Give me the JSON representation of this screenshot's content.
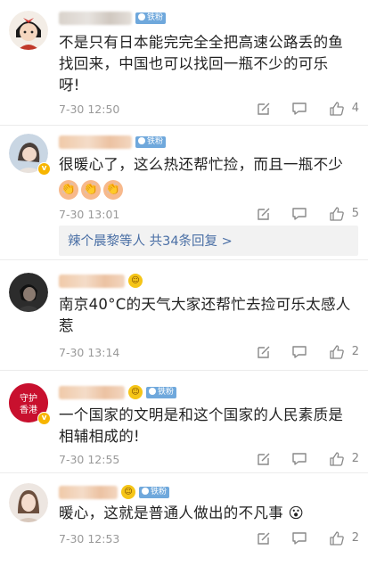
{
  "badges": {
    "fan_label": "铁粉"
  },
  "comments": [
    {
      "text_lines": [
        "不是只有日本能完完全全把高速公路丢的鱼",
        "找回来，中国也可以找回一瓶不少的可乐",
        "呀!"
      ],
      "time": "7-30 12:50",
      "likes": "4",
      "avatar_icon": "cartoon-girl-avatar",
      "has_fan_badge": true
    },
    {
      "text_lines": [
        "很暖心了，这么热还帮忙捡，而且一瓶不少"
      ],
      "emojis": [
        "clap-emoji",
        "clap-emoji",
        "clap-emoji"
      ],
      "time": "7-30 13:01",
      "likes": "5",
      "avatar_icon": "girl-photo-avatar",
      "has_fan_badge": true,
      "reply_summary": "辣个晨黎等人  共34条回复 >"
    },
    {
      "text_lines": [
        "南京40°C的天气大家还帮忙去捡可乐太感人",
        "惹"
      ],
      "time": "7-30 13:14",
      "likes": "2",
      "avatar_icon": "dark-portrait-avatar",
      "has_fan_badge": false
    },
    {
      "text_lines": [
        "一个国家的文明是和这个国家的人民素质是",
        "相辅相成的!"
      ],
      "time": "7-30 12:55",
      "likes": "2",
      "avatar_icon": "hongkong-logo-avatar",
      "avatar_text": [
        "守护",
        "香港"
      ],
      "has_fan_badge": true
    },
    {
      "text_lines": [
        "暖心，这就是普通人做出的不凡事 😮"
      ],
      "time": "7-30 12:53",
      "likes": "2",
      "avatar_icon": "woman-photo-avatar",
      "has_fan_badge": true
    }
  ],
  "colors": {
    "text": "#222222",
    "meta": "#999999",
    "link": "#4a6fa5",
    "fan_badge": "#6fa8dc",
    "verified": "#f7b500"
  }
}
